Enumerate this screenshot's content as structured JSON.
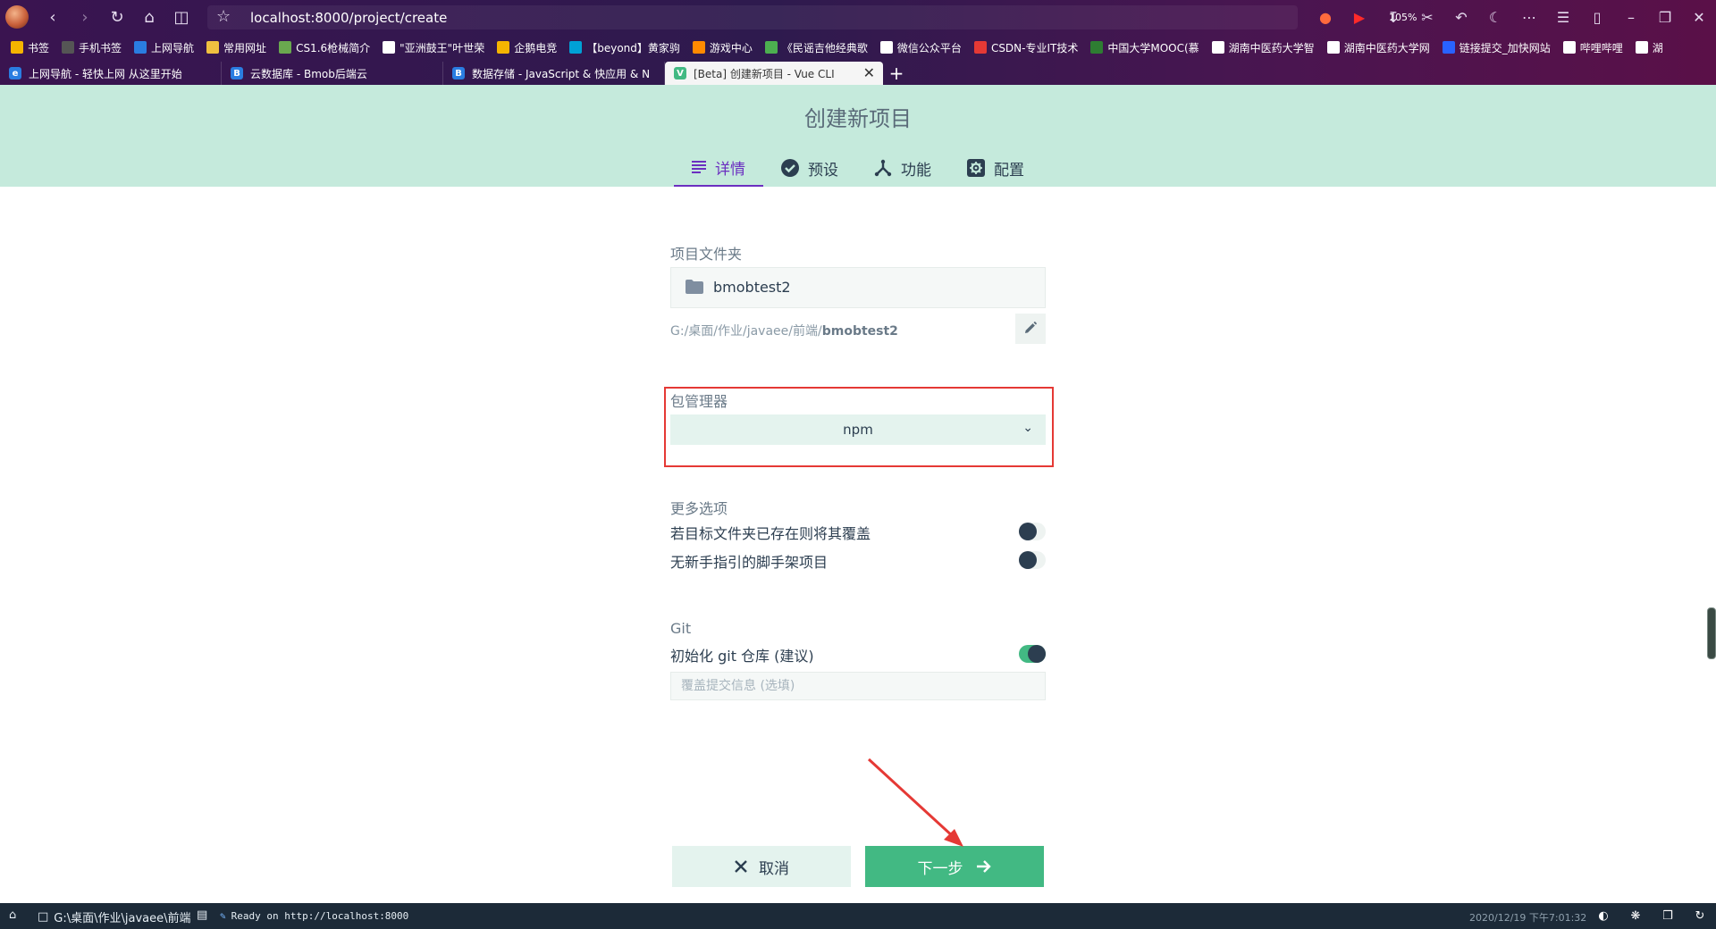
{
  "browser": {
    "url": "localhost:8000/project/create",
    "zoom": "105%",
    "bookmarks": [
      {
        "label": "书签",
        "color": "#f5b400"
      },
      {
        "label": "手机书签",
        "color": "#555555"
      },
      {
        "label": "上网导航",
        "color": "#2a7de1"
      },
      {
        "label": "常用网址",
        "color": "#f0c040"
      },
      {
        "label": "CS1.6枪械简介",
        "color": "#6aa84f"
      },
      {
        "label": "\"亚洲鼓王\"叶世荣",
        "color": "#ffffff"
      },
      {
        "label": "企鹅电竞",
        "color": "#f5b400"
      },
      {
        "label": "【beyond】黄家驹",
        "color": "#00a1d6"
      },
      {
        "label": "游戏中心",
        "color": "#ff8a00"
      },
      {
        "label": "《民谣吉他经典歌",
        "color": "#4caf50"
      },
      {
        "label": "微信公众平台",
        "color": "#ffffff"
      },
      {
        "label": "CSDN-专业IT技术",
        "color": "#e53935"
      },
      {
        "label": "中国大学MOOC(慕",
        "color": "#2e7d32"
      },
      {
        "label": "湖南中医药大学智",
        "color": "#ffffff"
      },
      {
        "label": "湖南中医药大学网",
        "color": "#ffffff"
      },
      {
        "label": "链接提交_加快网站",
        "color": "#2962ff"
      },
      {
        "label": "哔哩哔哩",
        "color": "#ffffff"
      },
      {
        "label": "湖",
        "color": "#ffffff"
      }
    ],
    "tabs": [
      {
        "title": "上网导航 - 轻快上网 从这里开始",
        "icon": "e",
        "color": "#2a7de1"
      },
      {
        "title": "云数据库 - Bmob后端云",
        "icon": "B",
        "color": "#2a7de1"
      },
      {
        "title": "数据存储 - JavaScript & 快应用 & N",
        "icon": "B",
        "color": "#2a7de1"
      },
      {
        "title": "[Beta] 创建新项目 - Vue CLI",
        "icon": "V",
        "color": "#42b983"
      }
    ]
  },
  "header": {
    "title": "创建新项目",
    "steps": [
      {
        "label": "详情",
        "icon": "list-icon"
      },
      {
        "label": "预设",
        "icon": "check-circle-icon"
      },
      {
        "label": "功能",
        "icon": "fork-icon"
      },
      {
        "label": "配置",
        "icon": "settings-box-icon"
      }
    ]
  },
  "form": {
    "folder_label": "项目文件夹",
    "folder_name": "bmobtest2",
    "path_prefix": "G:/桌面/作业/javaee/前端/",
    "path_bold": "bmobtest2",
    "package_manager_label": "包管理器",
    "package_manager_value": "npm",
    "more_options_label": "更多选项",
    "overwrite_label": "若目标文件夹已存在则将其覆盖",
    "overwrite_on": false,
    "no_guide_label": "无新手指引的脚手架项目",
    "no_guide_on": false,
    "git_label": "Git",
    "git_init_label": "初始化 git 仓库 (建议)",
    "git_init_on": true,
    "commit_placeholder": "覆盖提交信息 (选填)",
    "commit_value": ""
  },
  "actions": {
    "cancel_label": "取消",
    "next_label": "下一步"
  },
  "statusbar": {
    "cwd": "G:\\桌面\\作业\\javaee\\前端",
    "ready": "Ready on http://localhost:8000",
    "time": "2020/12/19 下午7:01:32"
  },
  "colors": {
    "accent": "#42b983",
    "active_step": "#6b2fc0",
    "header_bg": "#c5eadc",
    "annotation_red": "#e53935"
  }
}
